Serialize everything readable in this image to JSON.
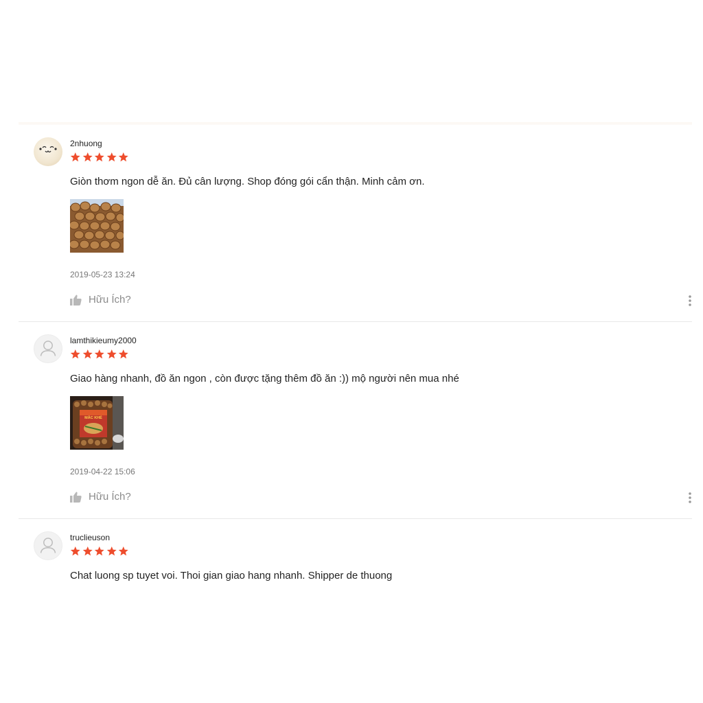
{
  "colors": {
    "star": "#ee4d2d",
    "muted_text": "#8a8a8a",
    "divider": "#e8e8e8"
  },
  "reviews": [
    {
      "username": "2nhuong",
      "avatar": "kaomoji-face-avatar",
      "rating": 5,
      "comment": "Giòn thơm ngon dễ ăn. Đủ cân lượng. Shop đóng gói cẩn thận. Minh cảm ơn.",
      "photo": "roasted-nuts-photo",
      "timestamp": "2019-05-23 13:24",
      "helpful_label": "Hữu Ích?"
    },
    {
      "username": "lamthikieumy2000",
      "avatar": "default-user-icon",
      "rating": 5,
      "comment": "Giao hàng nhanh, đồ ăn ngon , còn được tặng thêm đồ ăn :)) mộ người nên mua nhé",
      "photo": "nut-jar-photo",
      "photo_text": "MẮC KHÉ",
      "timestamp": "2019-04-22 15:06",
      "helpful_label": "Hữu Ích?"
    },
    {
      "username": "truclieuson",
      "avatar": "default-user-icon",
      "rating": 5,
      "comment": "Chat luong sp tuyet voi. Thoi gian giao hang nhanh. Shipper de thuong"
    }
  ]
}
